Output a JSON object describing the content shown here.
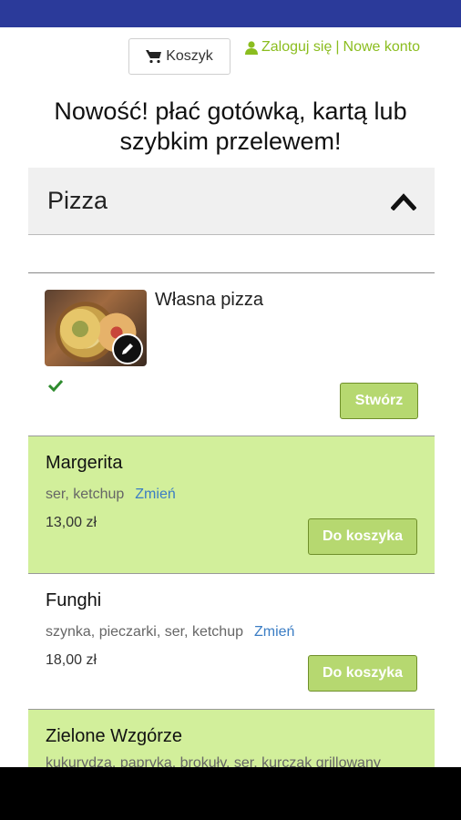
{
  "colors": {
    "status_bar": "#2b3a9a",
    "accent_green": "#8bbd1f",
    "row_green": "#d2ef9b",
    "button_green": "#b6d870",
    "link_blue": "#3b7dc4"
  },
  "header": {
    "cart_icon": "cart-icon",
    "cart_label": "Koszyk",
    "user_icon": "user-icon",
    "login_label": "Zaloguj się",
    "separator": "|",
    "register_label": "Nowe konto"
  },
  "promo": "Nowość! płać gotówką, kartą lub szybkim przelewem!",
  "category": {
    "title": "Pizza",
    "icon": "chevron-up-icon"
  },
  "custom_pizza": {
    "name": "Własna pizza",
    "edit_icon": "pencil-icon",
    "check_icon": "check-icon",
    "button": "Stwórz"
  },
  "products": [
    {
      "name": "Margerita",
      "ingredients": "ser, ketchup",
      "change": "Zmień",
      "price": "13,00 zł",
      "button": "Do koszyka"
    },
    {
      "name": "Funghi",
      "ingredients": "szynka, pieczarki, ser, ketchup",
      "change": "Zmień",
      "price": "18,00 zł",
      "button": "Do koszyka"
    },
    {
      "name": "Zielone Wzgórze",
      "ingredients": "kukurydza, papryka, brokuły, ser, kurczak grillowany"
    }
  ]
}
